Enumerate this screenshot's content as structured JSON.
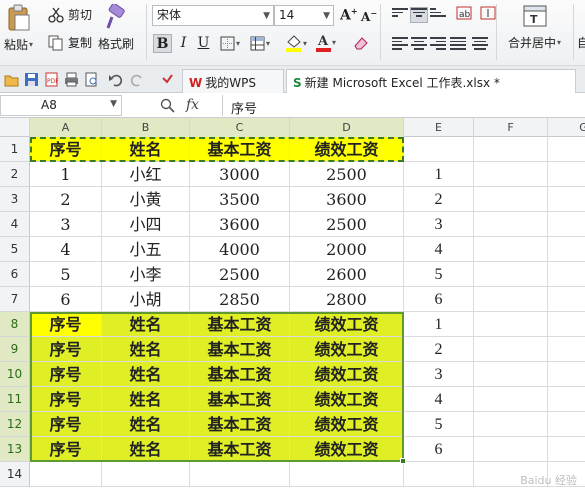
{
  "ribbon": {
    "paste_label": "粘贴",
    "cut_label": "剪切",
    "copy_label": "复制",
    "format_painter_label": "格式刷",
    "font_name": "宋体",
    "font_size": "14",
    "merge_center_label": "合并居中",
    "auto_label": "自"
  },
  "tabs": {
    "wps_tab": "我的WPS",
    "file_tab": "新建 Microsoft Excel 工作表.xlsx *"
  },
  "formula_bar": {
    "cell_ref": "A8",
    "fx_label": "fx",
    "content": "序号"
  },
  "columns": [
    "A",
    "B",
    "C",
    "D",
    "E",
    "F",
    "G"
  ],
  "rows": [
    {
      "num": "1",
      "cells": [
        "序号",
        "姓名",
        "基本工资",
        "绩效工资",
        ""
      ]
    },
    {
      "num": "2",
      "cells": [
        "1",
        "小红",
        "3000",
        "2500",
        "1"
      ]
    },
    {
      "num": "3",
      "cells": [
        "2",
        "小黄",
        "3500",
        "3600",
        "2"
      ]
    },
    {
      "num": "4",
      "cells": [
        "3",
        "小四",
        "3600",
        "2500",
        "3"
      ]
    },
    {
      "num": "5",
      "cells": [
        "4",
        "小五",
        "4000",
        "2000",
        "4"
      ]
    },
    {
      "num": "6",
      "cells": [
        "5",
        "小李",
        "2500",
        "2600",
        "5"
      ]
    },
    {
      "num": "7",
      "cells": [
        "6",
        "小胡",
        "2850",
        "2800",
        "6"
      ]
    },
    {
      "num": "8",
      "cells": [
        "序号",
        "姓名",
        "基本工资",
        "绩效工资",
        "1"
      ]
    },
    {
      "num": "9",
      "cells": [
        "序号",
        "姓名",
        "基本工资",
        "绩效工资",
        "2"
      ]
    },
    {
      "num": "10",
      "cells": [
        "序号",
        "姓名",
        "基本工资",
        "绩效工资",
        "3"
      ]
    },
    {
      "num": "11",
      "cells": [
        "序号",
        "姓名",
        "基本工资",
        "绩效工资",
        "4"
      ]
    },
    {
      "num": "12",
      "cells": [
        "序号",
        "姓名",
        "基本工资",
        "绩效工资",
        "5"
      ]
    },
    {
      "num": "13",
      "cells": [
        "序号",
        "姓名",
        "基本工资",
        "绩效工资",
        "6"
      ]
    },
    {
      "num": "14",
      "cells": [
        "",
        "",
        "",
        "",
        ""
      ]
    }
  ],
  "colors": {
    "header_fill": "#ffff00",
    "selection_fill": "#dfee25",
    "selection_border": "#5f9a31",
    "accent_green": "#3b7b1f"
  },
  "watermark": "Baidu 经验"
}
